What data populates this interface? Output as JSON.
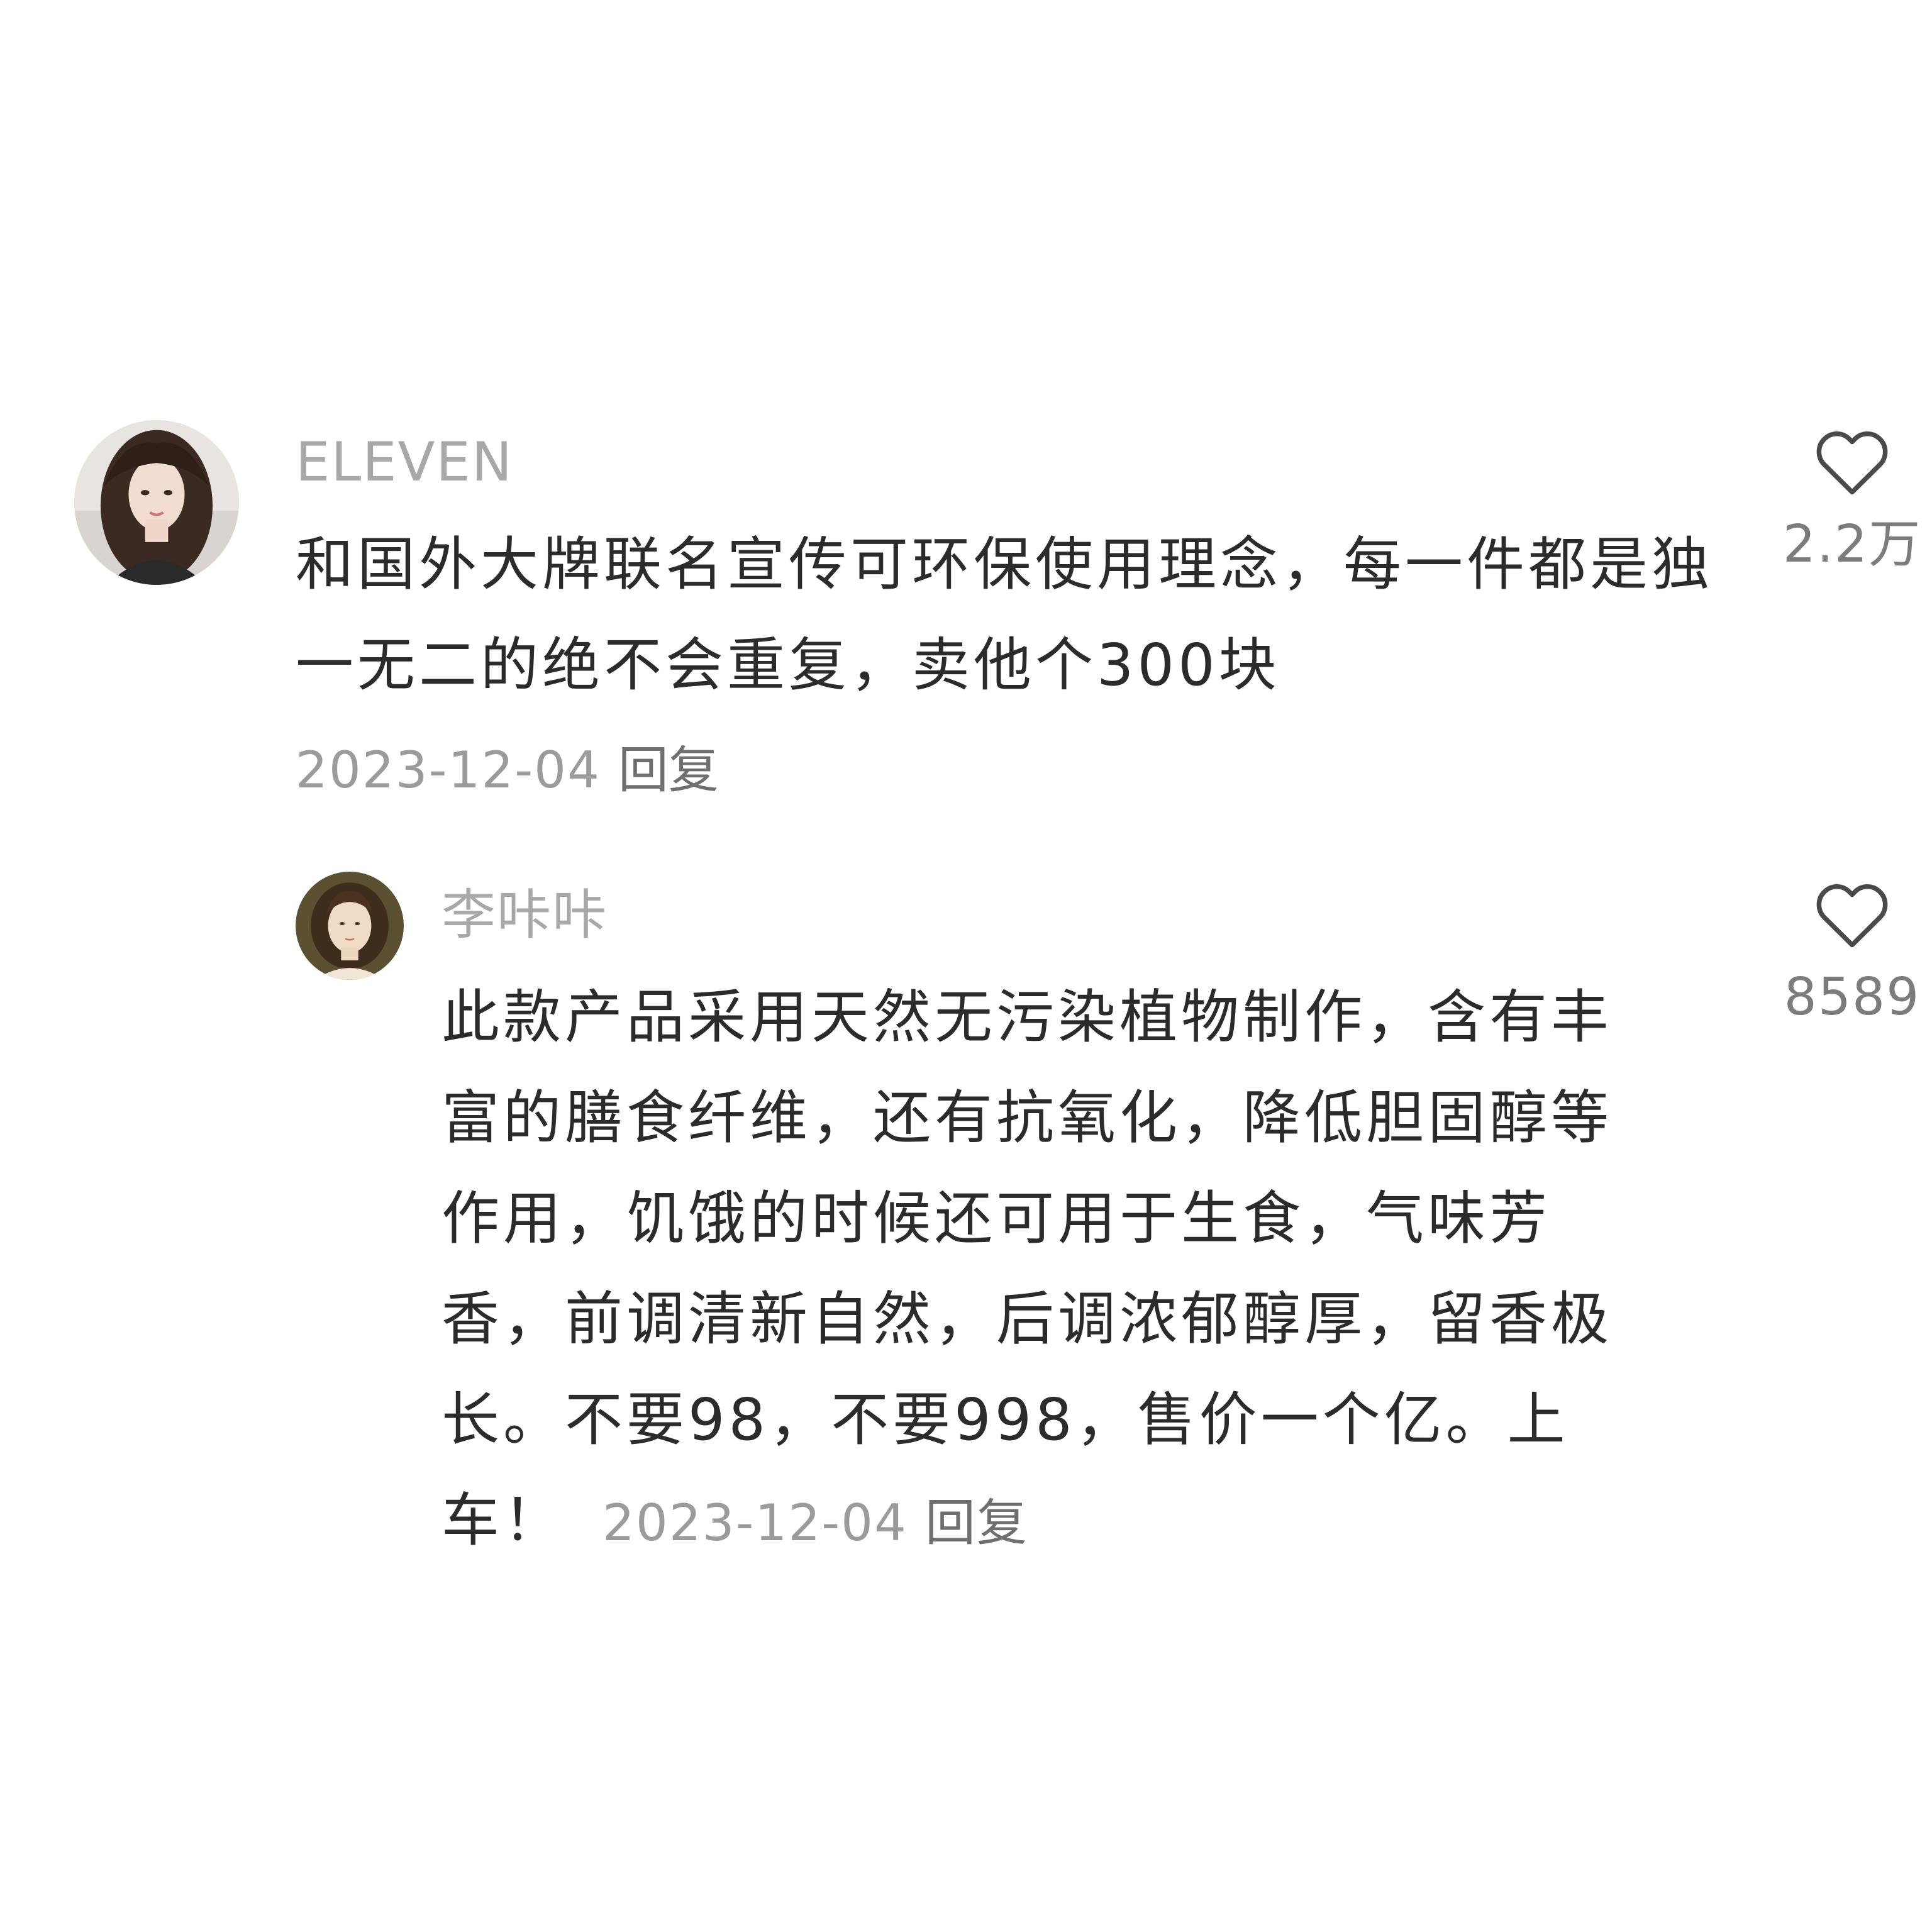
{
  "comments": [
    {
      "username": "ELEVEN",
      "avatar": "woman-portrait-photo",
      "text": "和国外大牌联名宣传可环保使用理念，每一件都是独一无二的绝不会重复，卖他个300块",
      "date": "2023-12-04",
      "reply_label": "回复",
      "likes": "2.2万"
    },
    {
      "username": "李咔咔",
      "avatar": "classical-painting-portrait",
      "text": "此款产品采用天然无污染植物制作，含有丰富的膳食纤维，还有抗氧化，降低胆固醇等作用，饥饿的时候还可用于生食，气味芳香，前调清新自然，后调浓郁醇厚，留香极长。不要98，不要998，售价一个亿。上车！",
      "date": "2023-12-04",
      "reply_label": "回复",
      "likes": "8589"
    }
  ],
  "icons": {
    "like": "heart-outline-icon"
  },
  "colors": {
    "username": "#a8a8a8",
    "body": "#2b2b2b",
    "date": "#9b9b9b",
    "reply": "#6f6f6f",
    "like_count": "#7c7c7c"
  }
}
